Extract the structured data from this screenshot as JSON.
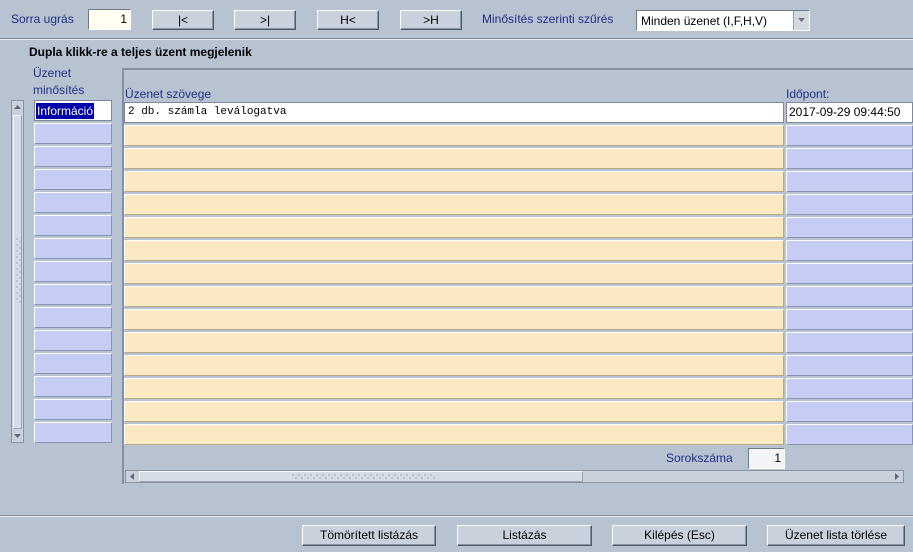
{
  "toolbar": {
    "jump_label": "Sorra ugrás",
    "jump_value": "1",
    "first_btn": "|<",
    "last_btn": ">|",
    "prev_btn": "H<",
    "next_btn": ">H",
    "filter_label": "Minősítés szerinti szűrés",
    "filter_selected": "Minden üzenet (I,F,H,V)"
  },
  "hint": "Dupla klikk-re a teljes üzent megjelenik",
  "columns": {
    "rating": "Üzenet minősítés",
    "text": "Üzenet szövege",
    "time": "Időpont:"
  },
  "rows": [
    {
      "rating": "Információ",
      "text": "2 db. számla leválogatva",
      "time": "2017-09-29 09:44:50"
    }
  ],
  "footer": {
    "row_count_label": "Sorokszáma",
    "row_count_value": "1"
  },
  "buttons": {
    "compressed": "Tömörített listázás",
    "list": "Listázás",
    "exit": "Kilépés (Esc)",
    "clear": "Üzenet lista törlése"
  }
}
